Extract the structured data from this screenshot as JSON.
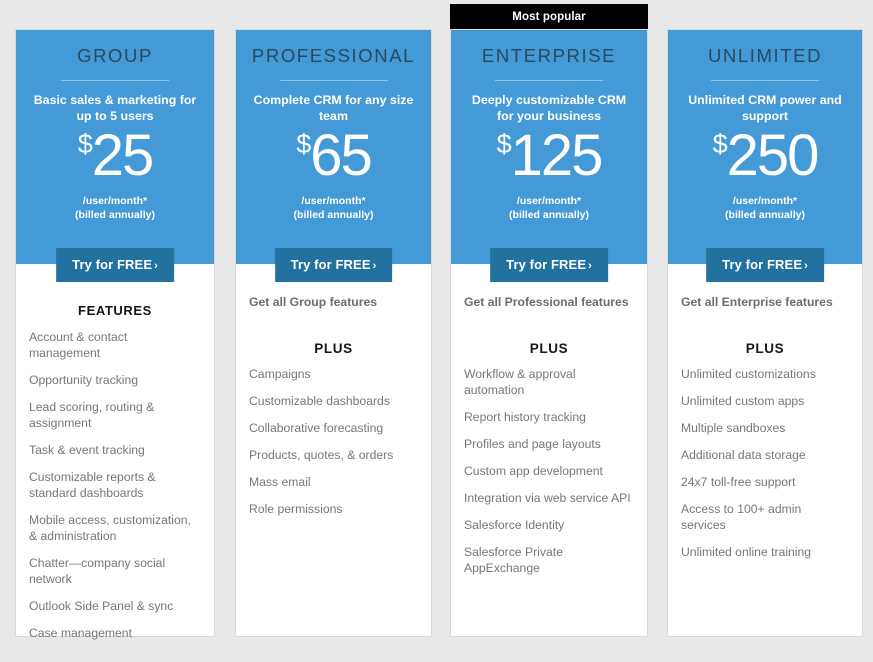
{
  "banner": {
    "label": "Most popular"
  },
  "colors": {
    "card_blue": "#449ad6",
    "cta_blue": "#22719f",
    "banner_black": "#000000",
    "page_bg": "#e8e8e8",
    "title_navy": "#2a4a63",
    "feature_gray": "#777777"
  },
  "common": {
    "cta_label": "Try for FREE",
    "cta_chevron": "›",
    "price_unit": "/user/month*",
    "price_billing": "(billed annually)",
    "currency": "$",
    "plus_heading": "PLUS",
    "features_heading": "FEATURES"
  },
  "plans": [
    {
      "id": "group",
      "title": "GROUP",
      "tagline": "Basic sales & marketing for up to 5 users",
      "price": "25",
      "currency": "$",
      "price_unit": "/user/month*",
      "price_billing": "(billed annually)",
      "cta_label": "Try for FREE",
      "section_heading": "FEATURES",
      "inherits": null,
      "plus_heading": null,
      "features": [
        "Account & contact management",
        "Opportunity tracking",
        "Lead scoring, routing & assignment",
        "Task & event tracking",
        "Customizable reports & standard dashboards",
        "Mobile access, customization, & administration",
        "Chatter—company social network",
        "Outlook Side Panel & sync",
        "Case management"
      ]
    },
    {
      "id": "professional",
      "title": "PROFESSIONAL",
      "tagline": "Complete CRM for any size team",
      "price": "65",
      "currency": "$",
      "price_unit": "/user/month*",
      "price_billing": "(billed annually)",
      "cta_label": "Try for FREE",
      "section_heading": null,
      "inherits": "Get all Group features",
      "plus_heading": "PLUS",
      "features": [
        "Campaigns",
        "Customizable dashboards",
        "Collaborative forecasting",
        "Products, quotes, & orders",
        "Mass email",
        "Role permissions"
      ]
    },
    {
      "id": "enterprise",
      "title": "ENTERPRISE",
      "tagline": "Deeply customizable CRM for your business",
      "price": "125",
      "currency": "$",
      "price_unit": "/user/month*",
      "price_billing": "(billed annually)",
      "cta_label": "Try for FREE",
      "section_heading": null,
      "inherits": "Get all Professional features",
      "plus_heading": "PLUS",
      "badge": "Most popular",
      "features": [
        "Workflow & approval automation",
        "Report history tracking",
        "Profiles and page layouts",
        "Custom app development",
        "Integration via web service API",
        "Salesforce Identity",
        "Salesforce Private AppExchange"
      ]
    },
    {
      "id": "unlimited",
      "title": "UNLIMITED",
      "tagline": "Unlimited CRM power and support",
      "price": "250",
      "currency": "$",
      "price_unit": "/user/month*",
      "price_billing": "(billed annually)",
      "cta_label": "Try for FREE",
      "section_heading": null,
      "inherits": "Get all Enterprise features",
      "plus_heading": "PLUS",
      "features": [
        "Unlimited customizations",
        "Unlimited custom apps",
        "Multiple sandboxes",
        "Additional data storage",
        "24x7 toll-free support",
        "Access to 100+ admin services",
        "Unlimited online training"
      ]
    }
  ]
}
